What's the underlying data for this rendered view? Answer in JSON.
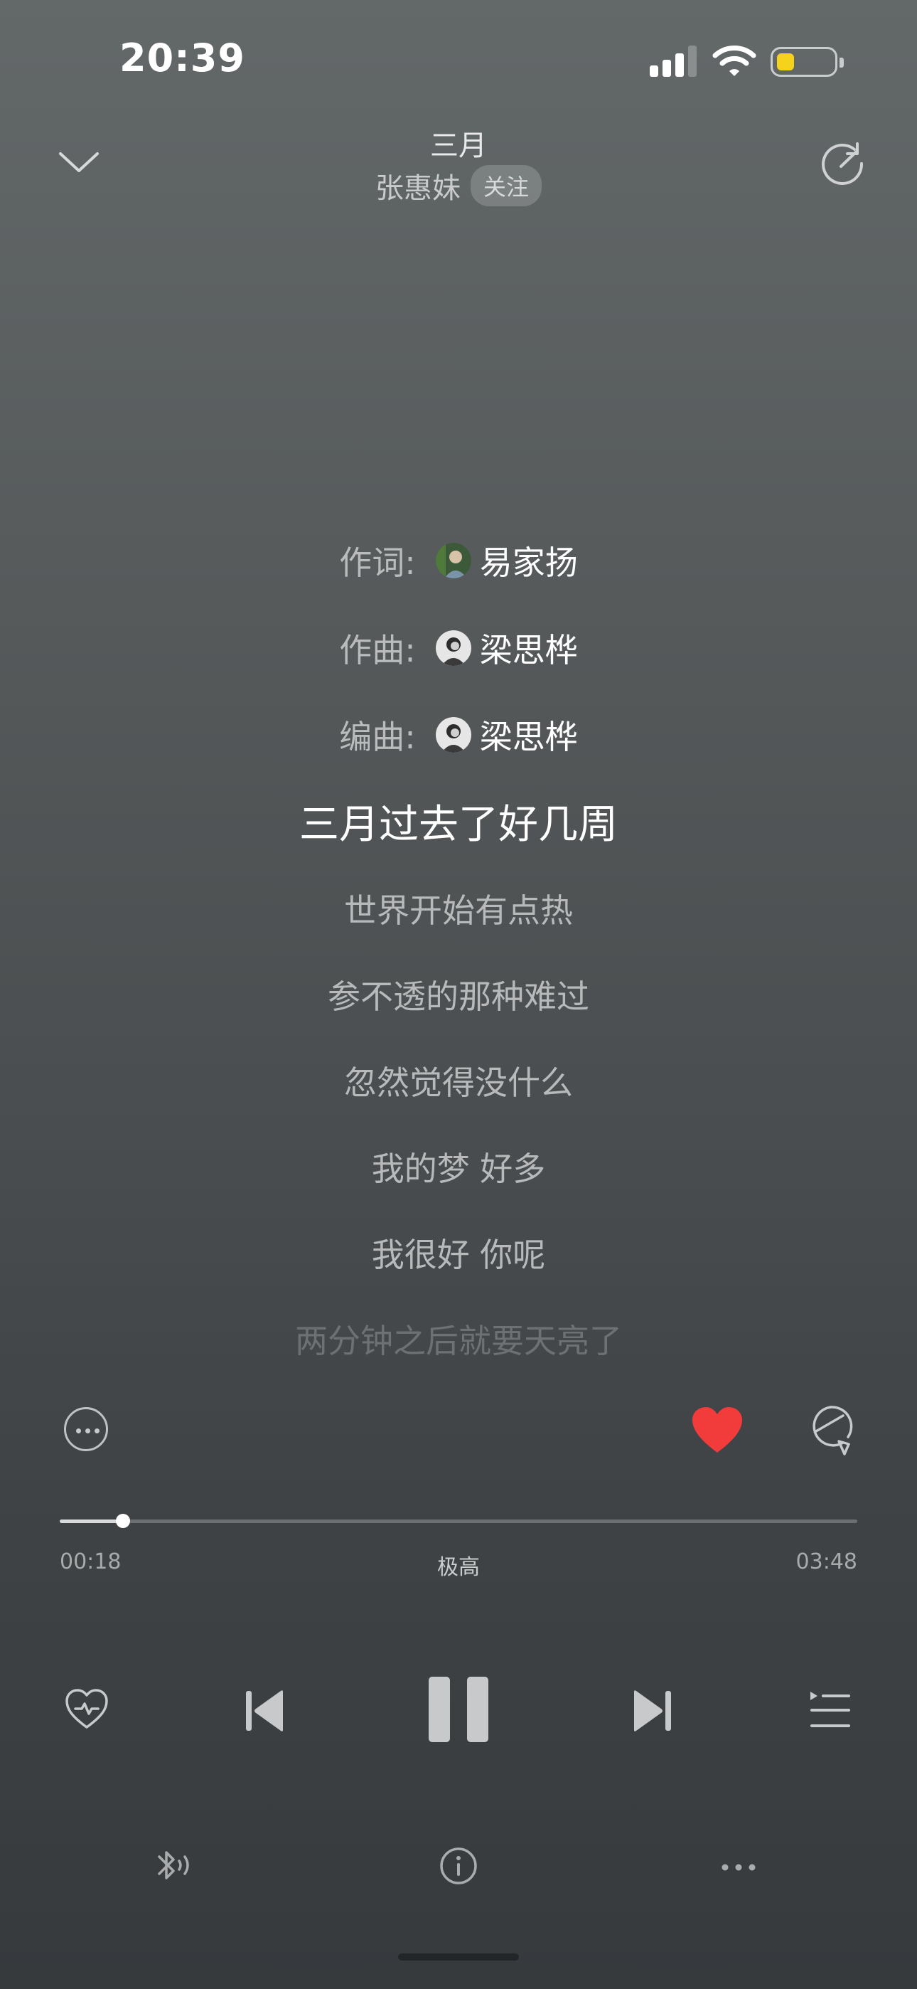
{
  "status_bar": {
    "time": "20:39"
  },
  "header": {
    "song_title": "三月",
    "artist": "张惠妹",
    "follow_label": "关注"
  },
  "credits": [
    {
      "role": "作词:",
      "name": "易家扬"
    },
    {
      "role": "作曲:",
      "name": "梁思桦"
    },
    {
      "role": "编曲:",
      "name": "梁思桦"
    }
  ],
  "lyrics": [
    "三月过去了好几周",
    "世界开始有点热",
    "参不透的那种难过",
    "忽然觉得没什么",
    "我的梦 好多",
    "我很好 你呢",
    "两分钟之后就要天亮了"
  ],
  "player": {
    "elapsed": "00:18",
    "duration": "03:48",
    "quality": "极高",
    "progress_fraction": 0.079,
    "liked": true,
    "like_color": "#f23b3b"
  },
  "icons": {
    "collapse": "chevron-down-icon",
    "share": "share-icon",
    "more": "more-icon",
    "like": "heart-icon",
    "comment": "comment-icon",
    "heartbeat": "heartbeat-mode-icon",
    "previous": "previous-icon",
    "pause": "pause-icon",
    "next": "next-icon",
    "playlist": "playlist-icon",
    "bluetooth": "bluetooth-audio-icon",
    "info": "info-icon",
    "overflow": "overflow-icon"
  }
}
